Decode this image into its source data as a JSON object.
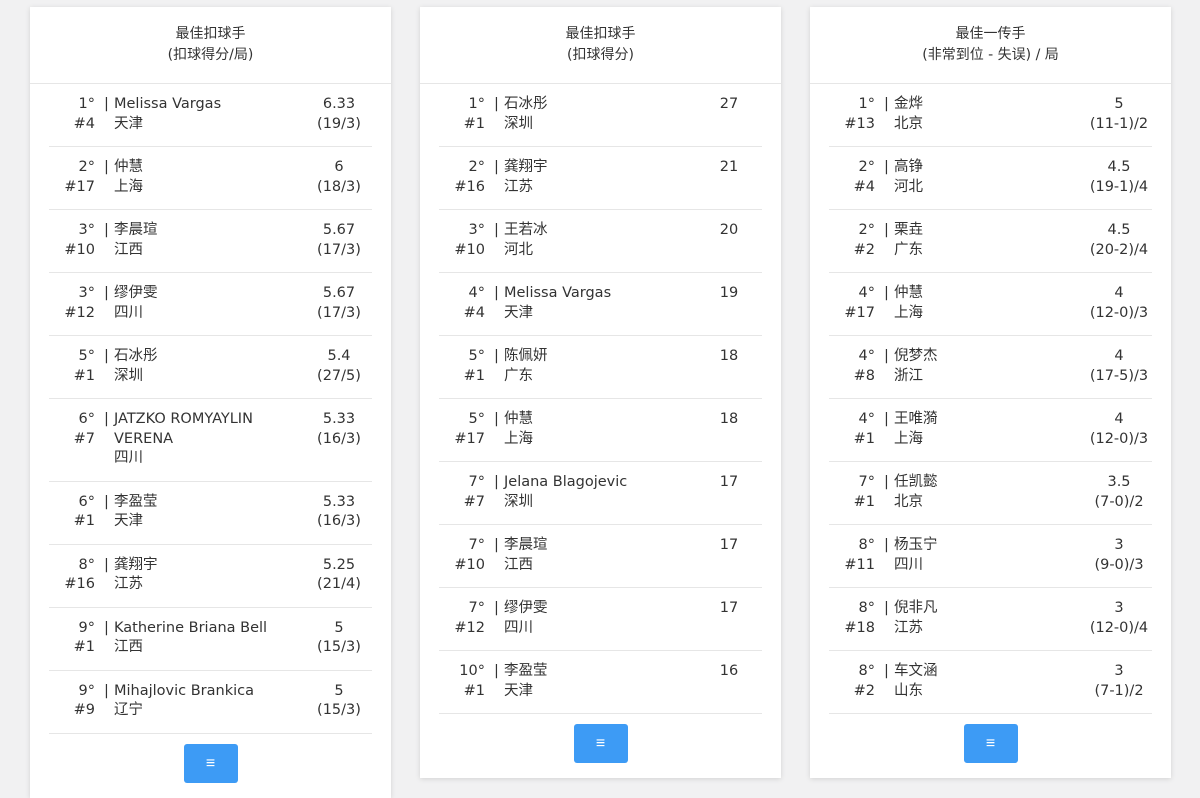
{
  "cards": [
    {
      "title": "最佳扣球手",
      "subtitle": "(扣球得分/局)",
      "rows": [
        {
          "rank": "1°",
          "number": "#4",
          "name": "Melissa Vargas",
          "team": "天津",
          "value": "6.33",
          "detail": "(19/3)"
        },
        {
          "rank": "2°",
          "number": "#17",
          "name": "仲慧",
          "team": "上海",
          "value": "6",
          "detail": "(18/3)"
        },
        {
          "rank": "3°",
          "number": "#10",
          "name": "李晨瑄",
          "team": "江西",
          "value": "5.67",
          "detail": "(17/3)"
        },
        {
          "rank": "3°",
          "number": "#12",
          "name": "缪伊雯",
          "team": "四川",
          "value": "5.67",
          "detail": "(17/3)"
        },
        {
          "rank": "5°",
          "number": "#1",
          "name": "石冰彤",
          "team": "深圳",
          "value": "5.4",
          "detail": "(27/5)"
        },
        {
          "rank": "6°",
          "number": "#7",
          "name": "JATZKO ROMYAYLIN VERENA",
          "team": "四川",
          "value": "5.33",
          "detail": "(16/3)"
        },
        {
          "rank": "6°",
          "number": "#1",
          "name": "李盈莹",
          "team": "天津",
          "value": "5.33",
          "detail": "(16/3)"
        },
        {
          "rank": "8°",
          "number": "#16",
          "name": "龚翔宇",
          "team": "江苏",
          "value": "5.25",
          "detail": "(21/4)"
        },
        {
          "rank": "9°",
          "number": "#1",
          "name": "Katherine Briana Bell",
          "team": "江西",
          "value": "5",
          "detail": "(15/3)"
        },
        {
          "rank": "9°",
          "number": "#9",
          "name": "Mihajlovic Brankica",
          "team": "辽宁",
          "value": "5",
          "detail": "(15/3)"
        }
      ],
      "button_icon": "≡"
    },
    {
      "title": "最佳扣球手",
      "subtitle": "(扣球得分)",
      "rows": [
        {
          "rank": "1°",
          "number": "#1",
          "name": "石冰彤",
          "team": "深圳",
          "value": "27",
          "detail": ""
        },
        {
          "rank": "2°",
          "number": "#16",
          "name": "龚翔宇",
          "team": "江苏",
          "value": "21",
          "detail": ""
        },
        {
          "rank": "3°",
          "number": "#10",
          "name": "王若冰",
          "team": "河北",
          "value": "20",
          "detail": ""
        },
        {
          "rank": "4°",
          "number": "#4",
          "name": "Melissa Vargas",
          "team": "天津",
          "value": "19",
          "detail": ""
        },
        {
          "rank": "5°",
          "number": "#1",
          "name": "陈佩妍",
          "team": "广东",
          "value": "18",
          "detail": ""
        },
        {
          "rank": "5°",
          "number": "#17",
          "name": "仲慧",
          "team": "上海",
          "value": "18",
          "detail": ""
        },
        {
          "rank": "7°",
          "number": "#7",
          "name": "Jelana Blagojevic",
          "team": "深圳",
          "value": "17",
          "detail": ""
        },
        {
          "rank": "7°",
          "number": "#10",
          "name": "李晨瑄",
          "team": "江西",
          "value": "17",
          "detail": ""
        },
        {
          "rank": "7°",
          "number": "#12",
          "name": "缪伊雯",
          "team": "四川",
          "value": "17",
          "detail": ""
        },
        {
          "rank": "10°",
          "number": "#1",
          "name": "李盈莹",
          "team": "天津",
          "value": "16",
          "detail": ""
        }
      ],
      "button_icon": "≡"
    },
    {
      "title": "最佳一传手",
      "subtitle": "(非常到位 - 失误) / 局",
      "rows": [
        {
          "rank": "1°",
          "number": "#13",
          "name": "金烨",
          "team": "北京",
          "value": "5",
          "detail": "(11-1)/2"
        },
        {
          "rank": "2°",
          "number": "#4",
          "name": "高铮",
          "team": "河北",
          "value": "4.5",
          "detail": "(19-1)/4"
        },
        {
          "rank": "2°",
          "number": "#2",
          "name": "栗垚",
          "team": "广东",
          "value": "4.5",
          "detail": "(20-2)/4"
        },
        {
          "rank": "4°",
          "number": "#17",
          "name": "仲慧",
          "team": "上海",
          "value": "4",
          "detail": "(12-0)/3"
        },
        {
          "rank": "4°",
          "number": "#8",
          "name": "倪梦杰",
          "team": "浙江",
          "value": "4",
          "detail": "(17-5)/3"
        },
        {
          "rank": "4°",
          "number": "#1",
          "name": "王唯漪",
          "team": "上海",
          "value": "4",
          "detail": "(12-0)/3"
        },
        {
          "rank": "7°",
          "number": "#1",
          "name": "任凯懿",
          "team": "北京",
          "value": "3.5",
          "detail": "(7-0)/2"
        },
        {
          "rank": "8°",
          "number": "#11",
          "name": "杨玉宁",
          "team": "四川",
          "value": "3",
          "detail": "(9-0)/3"
        },
        {
          "rank": "8°",
          "number": "#18",
          "name": "倪非凡",
          "team": "江苏",
          "value": "3",
          "detail": "(12-0)/4"
        },
        {
          "rank": "8°",
          "number": "#2",
          "name": "车文涵",
          "team": "山东",
          "value": "3",
          "detail": "(7-1)/2"
        }
      ],
      "button_icon": "≡"
    }
  ]
}
